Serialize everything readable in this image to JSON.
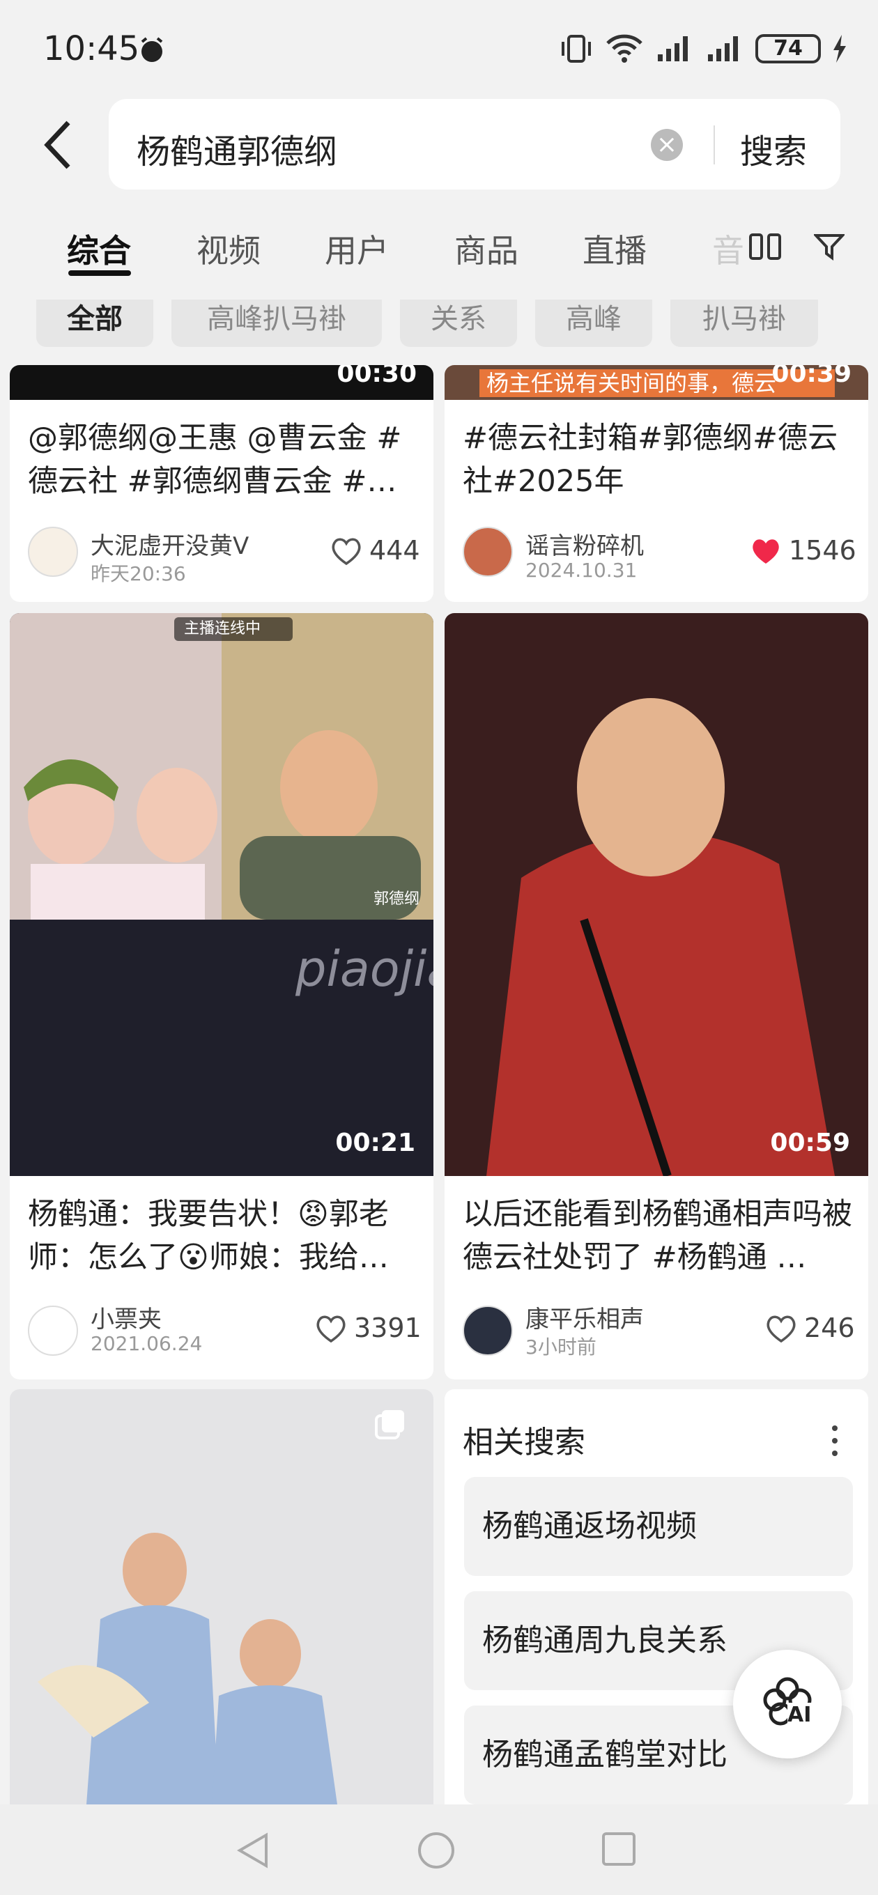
{
  "status": {
    "time": "10:45",
    "battery": "74"
  },
  "search": {
    "query": "杨鹤通郭德纲",
    "button": "搜索"
  },
  "tabs": [
    "综合",
    "视频",
    "用户",
    "商品",
    "直播",
    "音"
  ],
  "chips": [
    "全部",
    "高峰扒马褂",
    "关系",
    "高峰",
    "扒马褂"
  ],
  "cards": [
    {
      "duration": "00:30",
      "title": "@郭德纲@王惠 @曹云金 #德云社 #郭德纲曹云金 #…",
      "author": "大泥虚开没黄V",
      "date": "昨天20:36",
      "likes": "444",
      "liked": false
    },
    {
      "duration": "00:39",
      "overlay": "杨主任说有关时间的事，德云",
      "title": "#德云社封箱#郭德纲#德云社#2025年",
      "author": "谣言粉碎机",
      "date": "2024.10.31",
      "likes": "1546",
      "liked": true
    },
    {
      "duration": "00:21",
      "live_badge": "主播连线中",
      "watermark": "piaojia",
      "name_tag": "郭德纲",
      "title": "杨鹤通：我要告状！😡郭老师：怎么了😮师娘：我给…",
      "author": "小票夹",
      "date": "2021.06.24",
      "likes": "3391",
      "liked": false
    },
    {
      "duration": "00:59",
      "title": "以后还能看到杨鹤通相声吗被德云社处罚了 #杨鹤通 …",
      "author": "康平乐相声",
      "date": "3小时前",
      "likes": "246",
      "liked": false
    }
  ],
  "related": {
    "title": "相关搜索",
    "items": [
      "杨鹤通返场视频",
      "杨鹤通周九良关系",
      "杨鹤通孟鹤堂对比"
    ]
  },
  "ai_button": "AI",
  "colors": {
    "liked": "#f0284a",
    "accent": "#111111",
    "background": "#f2f2f2"
  }
}
